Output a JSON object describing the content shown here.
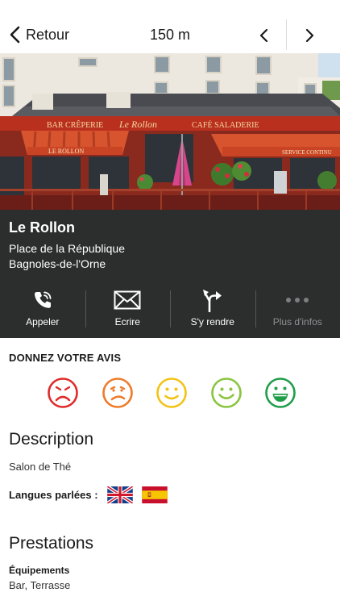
{
  "topbar": {
    "back_label": "Retour",
    "distance": "150 m",
    "prev_icon": "chevron-left-icon",
    "next_icon": "chevron-right-icon"
  },
  "place": {
    "name": "Le Rollon",
    "address_line1": "Place de la République",
    "address_line2": "Bagnoles-de-l'Orne"
  },
  "photo": {
    "awning_left": "BAR CRÊPERIE",
    "awning_sign": "Le Rollon",
    "awning_right": "CAFÉ SALADERIE",
    "awning_small": "LE ROLLON",
    "awning_service": "SERVICE CONTINU"
  },
  "actions": [
    {
      "label": "Appeler",
      "icon": "phone-icon",
      "enabled": true
    },
    {
      "label": "Ecrire",
      "icon": "envelope-icon",
      "enabled": true
    },
    {
      "label": "S'y rendre",
      "icon": "directions-icon",
      "enabled": true
    },
    {
      "label": "Plus d'infos",
      "icon": "more-dots-icon",
      "enabled": false
    }
  ],
  "rating": {
    "title": "DONNEZ VOTRE AVIS",
    "levels": [
      {
        "name": "very-bad",
        "color": "#e02b2b"
      },
      {
        "name": "bad",
        "color": "#ee7b2a"
      },
      {
        "name": "neutral",
        "color": "#f2c316"
      },
      {
        "name": "good",
        "color": "#8ac43f"
      },
      {
        "name": "very-good",
        "color": "#1f9e49"
      }
    ]
  },
  "description": {
    "title": "Description",
    "text": "Salon de Thé",
    "languages_label": "Langues parlées :",
    "languages": [
      "english-flag",
      "spanish-flag"
    ]
  },
  "prestations": {
    "title": "Prestations",
    "equipements_label": "Équipements",
    "equipements_value": "Bar, Terrasse"
  },
  "colors": {
    "panel_bg": "#2c2e2e",
    "awning_red": "#c8361f",
    "text_dark": "#1a1a1a"
  }
}
